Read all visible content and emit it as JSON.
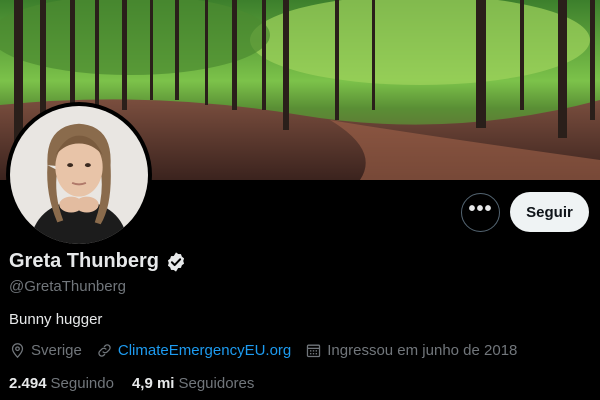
{
  "profile": {
    "display_name": "Greta Thunberg",
    "handle": "@GretaThunberg",
    "bio": "Bunny hugger",
    "verified": true
  },
  "actions": {
    "more_label": "•••",
    "follow_label": "Seguir"
  },
  "meta": {
    "location": "Sverige",
    "website": "ClimateEmergencyEU.org",
    "joined": "Ingressou em junho de 2018"
  },
  "stats": {
    "following_count": "2.494",
    "following_label": "Seguindo",
    "followers_count": "4,9 mi",
    "followers_label": "Seguidores"
  },
  "colors": {
    "background": "#000000",
    "primary_text": "#e7e9ea",
    "secondary_text": "#71767b",
    "link": "#1d9bf0",
    "follow_button_bg": "#eff3f4"
  },
  "icons": {
    "verified": "verified-badge-icon",
    "location": "location-pin-icon",
    "website": "link-icon",
    "joined": "calendar-icon",
    "more": "more-horizontal-icon"
  }
}
